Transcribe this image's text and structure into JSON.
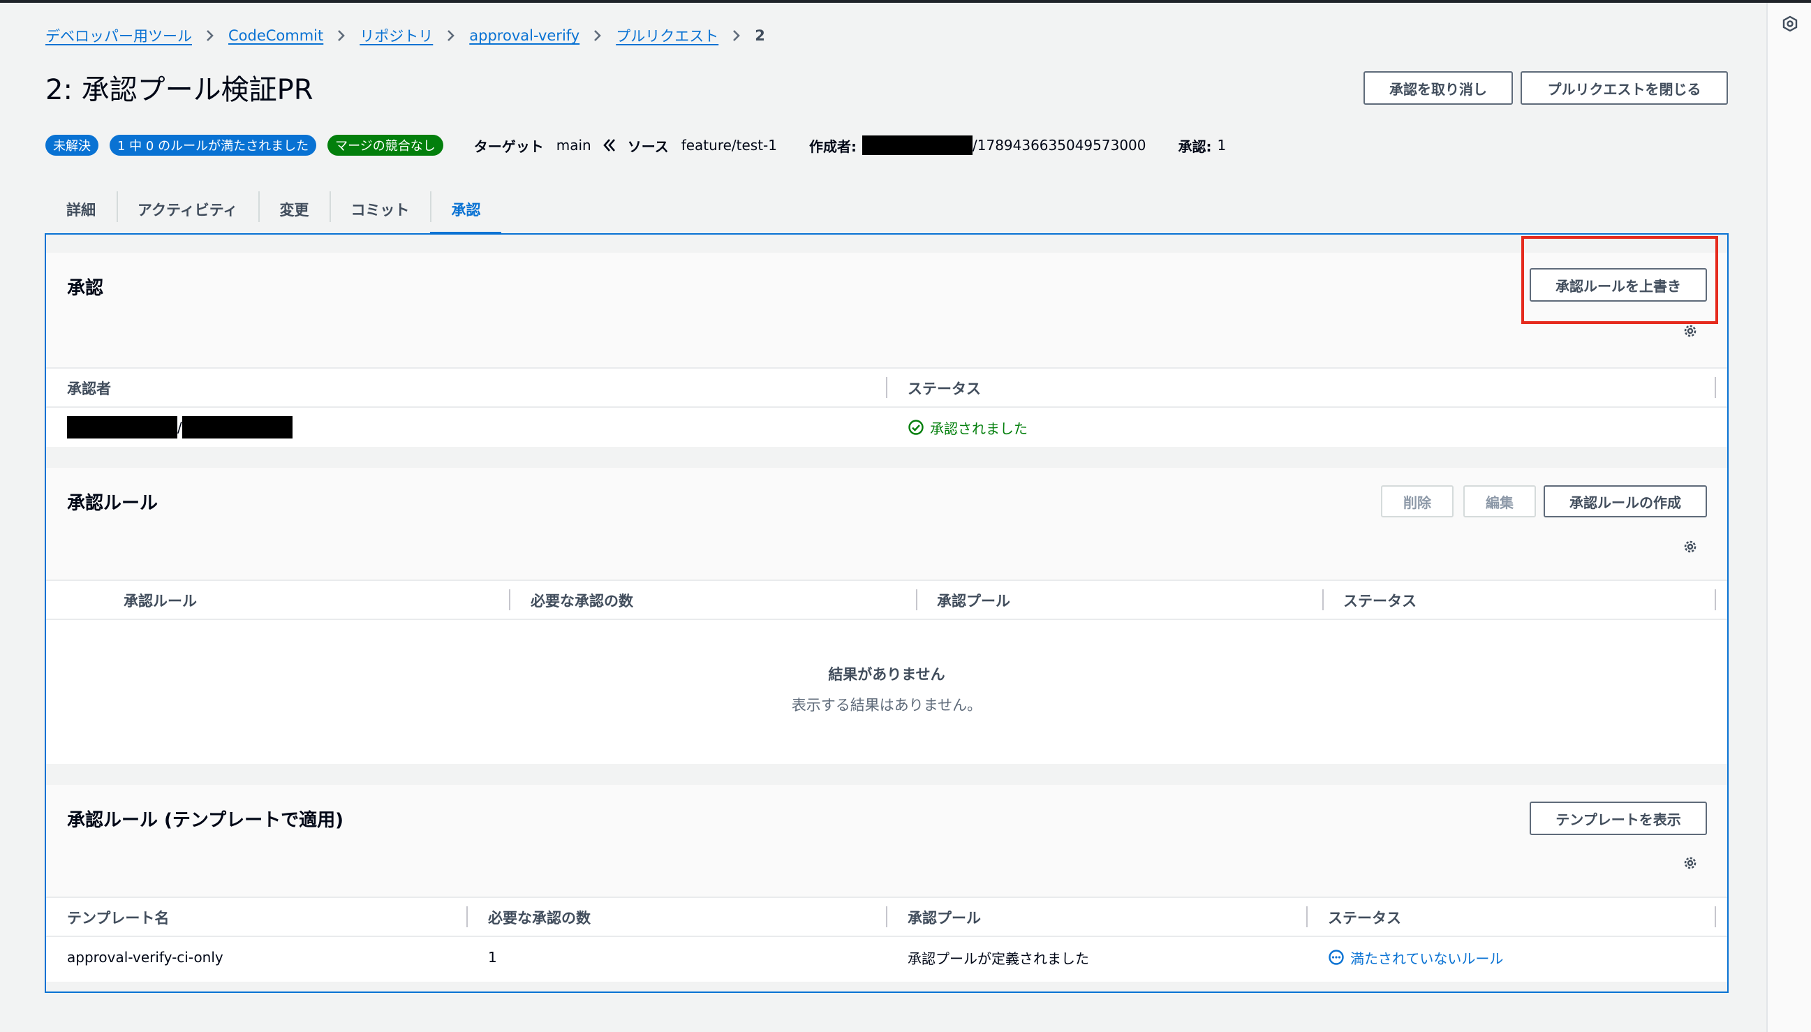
{
  "breadcrumb": {
    "items": [
      "デベロッパー用ツール",
      "CodeCommit",
      "リポジトリ",
      "approval-verify",
      "プルリクエスト"
    ],
    "current": "2"
  },
  "header": {
    "title": "2: 承認プール検証PR",
    "revoke_button": "承認を取り消し",
    "close_button": "プルリクエストを閉じる"
  },
  "meta": {
    "status_badge": "未解決",
    "rules_badge": "1 中 0 のルールが満たされました",
    "merge_badge": "マージの競合なし",
    "target_label": "ターゲット",
    "target_value": "main",
    "source_label": "ソース",
    "source_value": "feature/test-1",
    "author_label": "作成者:",
    "author_suffix": "/1789436635049573000",
    "approvals_label": "承認:",
    "approvals_value": "1",
    "colors": {
      "open": "#0972d3",
      "rules": "#0972d3",
      "merge": "#037f0c"
    }
  },
  "tabs": [
    "詳細",
    "アクティビティ",
    "変更",
    "コミット",
    "承認"
  ],
  "active_tab": "承認",
  "approvals": {
    "title": "承認",
    "override_button": "承認ルールを上書き",
    "columns": [
      "承認者",
      "ステータス"
    ],
    "rows": [
      {
        "approver_sep": "/",
        "status": "承認されました"
      }
    ]
  },
  "approval_rules": {
    "title": "承認ルール",
    "delete_button": "削除",
    "edit_button": "編集",
    "create_button": "承認ルールの作成",
    "columns": [
      "承認ルール",
      "必要な承認の数",
      "承認プール",
      "ステータス"
    ],
    "empty_title": "結果がありません",
    "empty_sub": "表示する結果はありません。"
  },
  "template_rules": {
    "title": "承認ルール (テンプレートで適用)",
    "view_button": "テンプレートを表示",
    "columns": [
      "テンプレート名",
      "必要な承認の数",
      "承認プール",
      "ステータス"
    ],
    "rows": [
      {
        "name": "approval-verify-ci-only",
        "required": "1",
        "pool": "承認プールが定義されました",
        "status": "満たされていないルール"
      }
    ]
  }
}
